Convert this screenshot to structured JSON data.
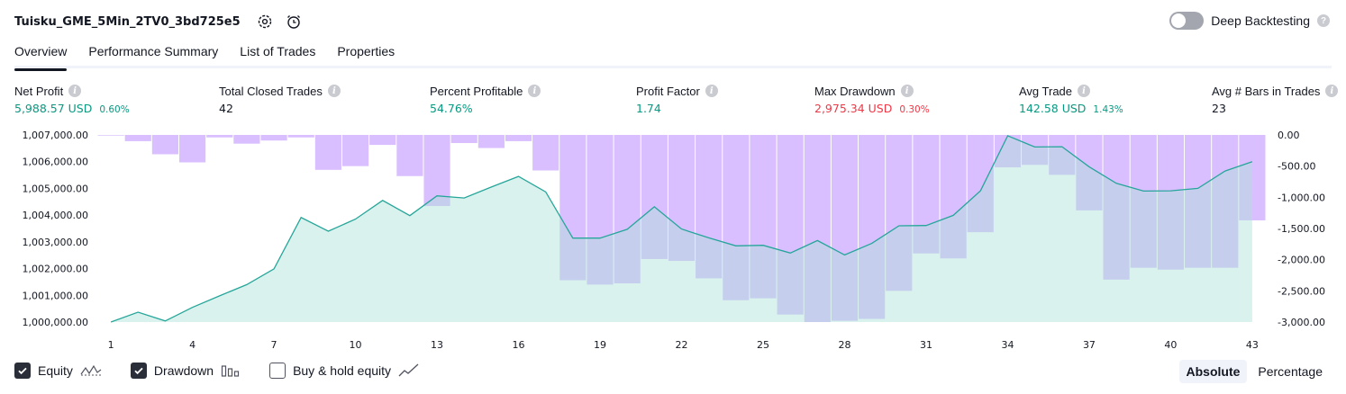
{
  "header": {
    "title": "Tuisku_GME_5Min_2TV0_3bd725e5",
    "settings_icon": "gear-icon",
    "alert_icon": "alarm-add-icon"
  },
  "deep_backtesting": {
    "label": "Deep Backtesting",
    "enabled": false,
    "help_icon": "?"
  },
  "tabs": [
    {
      "label": "Overview",
      "active": true
    },
    {
      "label": "Performance Summary",
      "active": false
    },
    {
      "label": "List of Trades",
      "active": false
    },
    {
      "label": "Properties",
      "active": false
    }
  ],
  "metrics": [
    {
      "label": "Net Profit",
      "value": "5,988.57 USD",
      "pct": "0.60%",
      "color": "green"
    },
    {
      "label": "Total Closed Trades",
      "value": "42",
      "pct": "",
      "color": "dark"
    },
    {
      "label": "Percent Profitable",
      "value": "54.76%",
      "pct": "",
      "color": "green"
    },
    {
      "label": "Profit Factor",
      "value": "1.74",
      "pct": "",
      "color": "green"
    },
    {
      "label": "Max Drawdown",
      "value": "2,975.34 USD",
      "pct": "0.30%",
      "color": "red"
    },
    {
      "label": "Avg Trade",
      "value": "142.58 USD",
      "pct": "1.43%",
      "color": "green"
    },
    {
      "label": "Avg # Bars in Trades",
      "value": "23",
      "pct": "",
      "color": "dark"
    }
  ],
  "chart_data": {
    "type": "area",
    "x_ticks": [
      "1",
      "4",
      "7",
      "10",
      "13",
      "16",
      "19",
      "22",
      "25",
      "28",
      "31",
      "34",
      "37",
      "40",
      "43"
    ],
    "y_left_ticks": [
      "1,000,000.00",
      "1,001,000.00",
      "1,002,000.00",
      "1,003,000.00",
      "1,004,000.00",
      "1,005,000.00",
      "1,006,000.00",
      "1,007,000.00"
    ],
    "y_left_range": [
      1000000,
      1007000
    ],
    "y_right_ticks": [
      "-3,000.00",
      "-2,500.00",
      "-2,000.00",
      "-1,500.00",
      "-1,000.00",
      "-500.00",
      "0.00"
    ],
    "y_right_range": [
      -3000,
      0
    ],
    "x": [
      1,
      2,
      3,
      4,
      5,
      6,
      7,
      8,
      9,
      10,
      11,
      12,
      13,
      14,
      15,
      16,
      17,
      18,
      19,
      20,
      21,
      22,
      23,
      24,
      25,
      26,
      27,
      28,
      29,
      30,
      31,
      32,
      33,
      34,
      35,
      36,
      37,
      38,
      39,
      40,
      41,
      42,
      43
    ],
    "series": [
      {
        "name": "Equity",
        "axis": "left",
        "values": [
          1000000,
          1000370,
          1000040,
          1000550,
          1000980,
          1001400,
          1001990,
          1003910,
          1003400,
          1003850,
          1004550,
          1003980,
          1004720,
          1004640,
          1005050,
          1005450,
          1004870,
          1003140,
          1003140,
          1003470,
          1004310,
          1003480,
          1003150,
          1002850,
          1002870,
          1002580,
          1003050,
          1002510,
          1002940,
          1003600,
          1003610,
          1003990,
          1004910,
          1006970,
          1006550,
          1006560,
          1005810,
          1005190,
          1004900,
          1004910,
          1005000,
          1005650,
          1006000
        ]
      },
      {
        "name": "Drawdown",
        "axis": "right",
        "values": [
          -10,
          -100,
          -310,
          -440,
          -40,
          -140,
          -90,
          -40,
          -560,
          -500,
          -160,
          -660,
          -1140,
          -130,
          -210,
          -100,
          -570,
          -2330,
          -2400,
          -2380,
          -1990,
          -2020,
          -2300,
          -2650,
          -2620,
          -2880,
          -3000,
          -2980,
          -2950,
          -2500,
          -1900,
          -1980,
          -1560,
          -520,
          -480,
          -640,
          -1210,
          -2320,
          -2130,
          -2160,
          -2130,
          -2130,
          -1370
        ]
      }
    ],
    "colors": {
      "equity_line": "#26a69a",
      "equity_fill": "#d4f0e8",
      "drawdown_fill": "#d7bcff"
    }
  },
  "legend": {
    "items": [
      {
        "label": "Equity",
        "checked": true,
        "icon": "equity-line-icon"
      },
      {
        "label": "Drawdown",
        "checked": true,
        "icon": "drawdown-bars-icon"
      },
      {
        "label": "Buy & hold equity",
        "checked": false,
        "icon": "buy-hold-line-icon"
      }
    ]
  },
  "modes": {
    "absolute": "Absolute",
    "percentage": "Percentage",
    "selected": "Absolute"
  }
}
